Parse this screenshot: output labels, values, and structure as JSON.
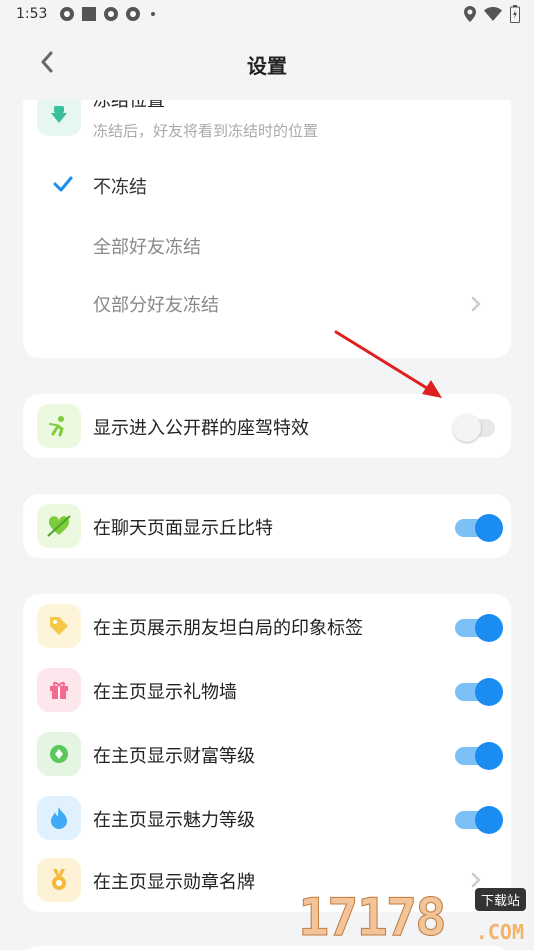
{
  "status_bar": {
    "time": "1:53"
  },
  "header": {
    "title": "设置"
  },
  "freeze_card": {
    "title": "冻结位置",
    "subtitle": "冻结后，好友将看到冻结时的位置",
    "options": [
      {
        "label": "不冻结",
        "selected": true
      },
      {
        "label": "全部好友冻结",
        "selected": false
      },
      {
        "label": "仅部分好友冻结",
        "selected": false
      }
    ]
  },
  "public_group_card": {
    "label": "显示进入公开群的座驾特效",
    "enabled": false
  },
  "cupid_card": {
    "label": "在聊天页面显示丘比特",
    "enabled": true
  },
  "profile_card": {
    "rows": [
      {
        "label": "在主页展示朋友坦白局的印象标签",
        "enabled": true,
        "icon": "tag-icon",
        "color": "#f6c84a"
      },
      {
        "label": "在主页显示礼物墙",
        "enabled": true,
        "icon": "gift-icon",
        "color": "#f46a8e"
      },
      {
        "label": "在主页显示财富等级",
        "enabled": true,
        "icon": "diamond-icon",
        "color": "#5cc85c"
      },
      {
        "label": "在主页显示魅力等级",
        "enabled": true,
        "icon": "flame-icon",
        "color": "#3fa9f5"
      },
      {
        "label": "在主页显示勋章名牌",
        "icon": "medal-icon",
        "color": "#f6b93b"
      }
    ]
  },
  "watermark": {
    "number": "17178",
    "tag": "下载站",
    "suffix": ".COM"
  },
  "colors": {
    "accent": "#1a8cf2",
    "background": "#f3f4f6",
    "annotation_arrow": "#e02020"
  }
}
